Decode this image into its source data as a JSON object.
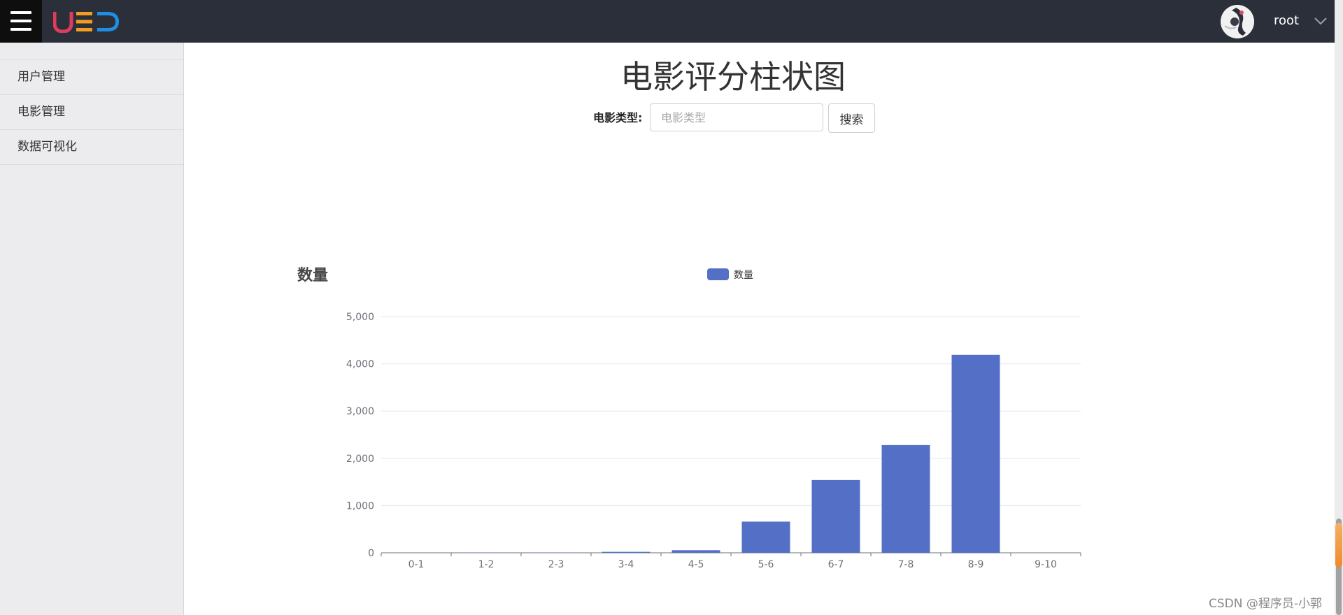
{
  "header": {
    "logo_text": "UED",
    "username": "root"
  },
  "sidebar": {
    "items": [
      {
        "label": "用户管理"
      },
      {
        "label": "电影管理"
      },
      {
        "label": "数据可视化"
      }
    ]
  },
  "main": {
    "title": "电影评分柱状图",
    "search": {
      "label": "电影类型:",
      "placeholder": "电影类型",
      "value": "",
      "button_label": "搜索"
    }
  },
  "chart_data": {
    "type": "bar",
    "title": "数量",
    "legend": [
      "数量"
    ],
    "legend_position": "top-center",
    "categories": [
      "0-1",
      "1-2",
      "2-3",
      "3-4",
      "4-5",
      "5-6",
      "6-7",
      "7-8",
      "8-9",
      "9-10"
    ],
    "series": [
      {
        "name": "数量",
        "color": "#5470c6",
        "values": [
          0,
          2,
          5,
          20,
          55,
          660,
          1540,
          2280,
          4190,
          0
        ]
      }
    ],
    "ylim": [
      0,
      5000
    ],
    "yticks": [
      "0",
      "1,000",
      "2,000",
      "3,000",
      "4,000",
      "5,000"
    ],
    "grid": true
  },
  "colors": {
    "topbar": "#2b2f3a",
    "sidebar": "#ececee",
    "bar": "#5470c6"
  },
  "watermark": "CSDN @程序员-小郭"
}
